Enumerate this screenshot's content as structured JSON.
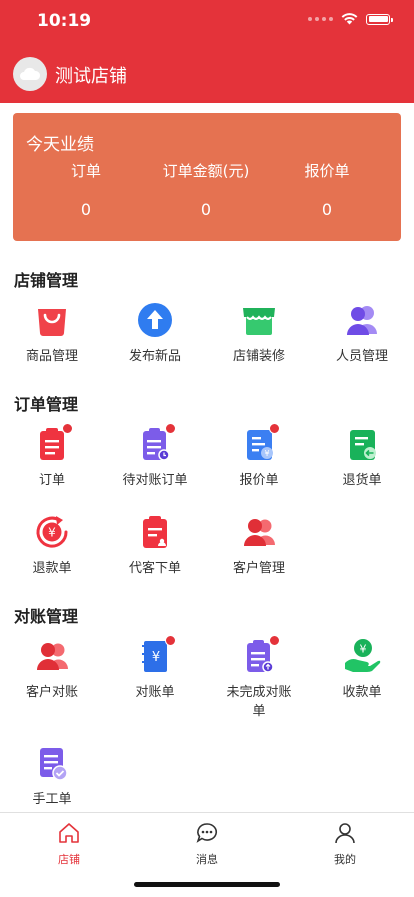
{
  "status_bar": {
    "time": "10:19"
  },
  "header": {
    "store_name": "测试店铺"
  },
  "performance": {
    "title": "今天业绩",
    "columns": [
      {
        "label": "订单",
        "value": "0"
      },
      {
        "label": "订单金额(元)",
        "value": "0"
      },
      {
        "label": "报价单",
        "value": "0"
      }
    ]
  },
  "sections": {
    "store": {
      "title": "店铺管理",
      "items": [
        {
          "label": "商品管理",
          "icon": "shopping-bag-icon"
        },
        {
          "label": "发布新品",
          "icon": "upload-arrow-icon"
        },
        {
          "label": "店铺装修",
          "icon": "storefront-icon"
        },
        {
          "label": "人员管理",
          "icon": "people-icon"
        }
      ]
    },
    "order": {
      "title": "订单管理",
      "items": [
        {
          "label": "订单",
          "icon": "order-doc-icon",
          "badge": true
        },
        {
          "label": "待对账订单",
          "icon": "pending-reconcile-icon",
          "badge": true
        },
        {
          "label": "报价单",
          "icon": "quote-doc-icon",
          "badge": true
        },
        {
          "label": "退货单",
          "icon": "return-doc-icon",
          "badge": false
        },
        {
          "label": "退款单",
          "icon": "refund-icon",
          "badge": false
        },
        {
          "label": "代客下单",
          "icon": "proxy-order-icon",
          "badge": false
        },
        {
          "label": "客户管理",
          "icon": "customers-icon",
          "badge": false
        }
      ]
    },
    "reconcile": {
      "title": "对账管理",
      "items": [
        {
          "label": "客户对账",
          "icon": "customer-reconcile-icon",
          "badge": false
        },
        {
          "label": "对账单",
          "icon": "statement-book-icon",
          "badge": true
        },
        {
          "label": "未完成对账单",
          "icon": "unfinished-statement-icon",
          "badge": true
        },
        {
          "label": "收款单",
          "icon": "receipt-icon",
          "badge": false
        },
        {
          "label": "手工单",
          "icon": "manual-doc-icon",
          "badge": false
        }
      ]
    }
  },
  "tabbar": {
    "items": [
      {
        "label": "店铺",
        "icon": "home-icon",
        "active": true
      },
      {
        "label": "消息",
        "icon": "chat-icon",
        "active": false
      },
      {
        "label": "我的",
        "icon": "user-icon",
        "active": false
      }
    ]
  },
  "colors": {
    "primary": "#e4333a",
    "card": "#e57251"
  }
}
